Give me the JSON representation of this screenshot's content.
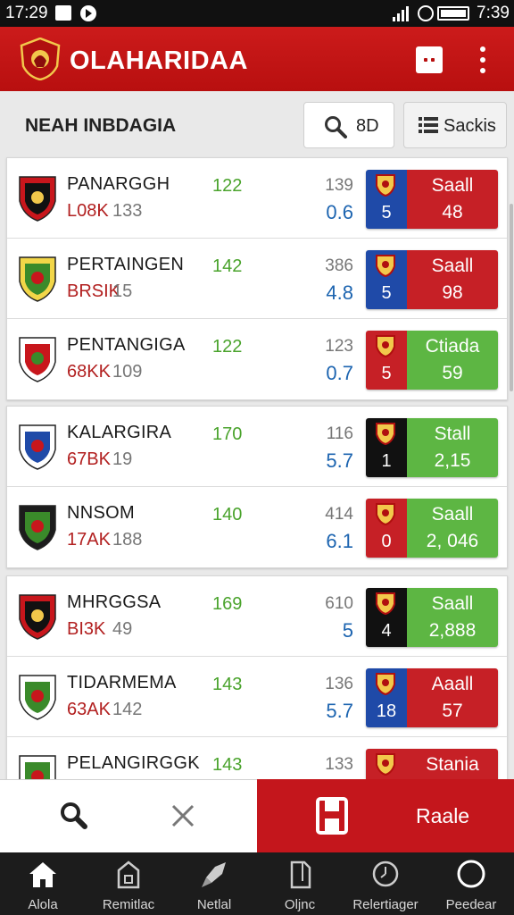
{
  "status_bar": {
    "time_left": "17:29",
    "time_right": "7:39"
  },
  "app_bar": {
    "title": "OLAHARIDAA",
    "logo_icon": "club-crest-logo",
    "menu_icon": "grid-menu-icon",
    "more_icon": "more-vertical-icon"
  },
  "filter_bar": {
    "heading": "NEAH INBDAGIA",
    "search_label": "8D",
    "sort_label": "Sackis"
  },
  "colors": {
    "brand_red": "#c4161c",
    "odds_red": "#c62026",
    "odds_green": "#5db643",
    "odds_blue": "#1f4aa8",
    "odds_black": "#111111",
    "stat_green": "#4aa32c",
    "stat_blue": "#1c64b0"
  },
  "groups": [
    {
      "rows": [
        {
          "name": "PANARGGH",
          "code": "L08K",
          "num": "133",
          "green": "122",
          "gray": "139",
          "blue": "0.6",
          "odds": {
            "left": "5",
            "top": "Saall",
            "bottom": "48",
            "left_color": "blue",
            "right_color": "red"
          }
        },
        {
          "name": "PERTAINGEN",
          "code": "BRSIK",
          "num": "15",
          "green": "142",
          "gray": "386",
          "blue": "4.8",
          "odds": {
            "left": "5",
            "top": "Saall",
            "bottom": "98",
            "left_color": "blue",
            "right_color": "red"
          }
        },
        {
          "name": "PENTANGIGA",
          "code": "68KK",
          "num": "109",
          "green": "122",
          "gray": "123",
          "blue": "0.7",
          "odds": {
            "left": "5",
            "top": "Ctiada",
            "bottom": "59",
            "left_color": "red",
            "right_color": "green"
          }
        }
      ]
    },
    {
      "rows": [
        {
          "name": "KALARGIRA",
          "code": "67BK",
          "num": "19",
          "green": "170",
          "gray": "116",
          "blue": "5.7",
          "odds": {
            "left": "1",
            "top": "Stall",
            "bottom": "2,15",
            "left_color": "black",
            "right_color": "green"
          }
        },
        {
          "name": "NNSOM",
          "code": "17AK",
          "num": "188",
          "green": "140",
          "gray": "414",
          "blue": "6.1",
          "odds": {
            "left": "0",
            "top": "Saall",
            "bottom": "2, 046",
            "left_color": "red",
            "right_color": "green"
          }
        }
      ]
    },
    {
      "rows": [
        {
          "name": "MHRGGSA",
          "code": "BI3K",
          "num": "49",
          "green": "169",
          "gray": "610",
          "blue": "5",
          "odds": {
            "left": "4",
            "top": "Saall",
            "bottom": "2,888",
            "left_color": "black",
            "right_color": "green"
          }
        },
        {
          "name": "TIDARMEMA",
          "code": "63AK",
          "num": "142",
          "green": "143",
          "gray": "136",
          "blue": "5.7",
          "odds": {
            "left": "18",
            "top": "Aaall",
            "bottom": "57",
            "left_color": "blue",
            "right_color": "red"
          }
        },
        {
          "name": "PELANGIRGGK",
          "code": "",
          "num": "",
          "green": "143",
          "gray": "133",
          "blue": "",
          "odds": {
            "left": "",
            "top": "Stania",
            "bottom": "",
            "left_color": "red",
            "right_color": "red"
          }
        }
      ]
    }
  ],
  "action_bar": {
    "search_icon": "search-icon",
    "close_icon": "close-icon",
    "action_icon": "ticket-icon",
    "action_label": "Raale"
  },
  "bottom_nav": [
    {
      "label": "Alola",
      "icon": "home-icon"
    },
    {
      "label": "Remitlac",
      "icon": "stadium-icon"
    },
    {
      "label": "Netlal",
      "icon": "rocket-icon"
    },
    {
      "label": "Oljnc",
      "icon": "document-icon"
    },
    {
      "label": "Relertiager",
      "icon": "clock-icon"
    },
    {
      "label": "Peedear",
      "icon": "circle-icon"
    }
  ]
}
